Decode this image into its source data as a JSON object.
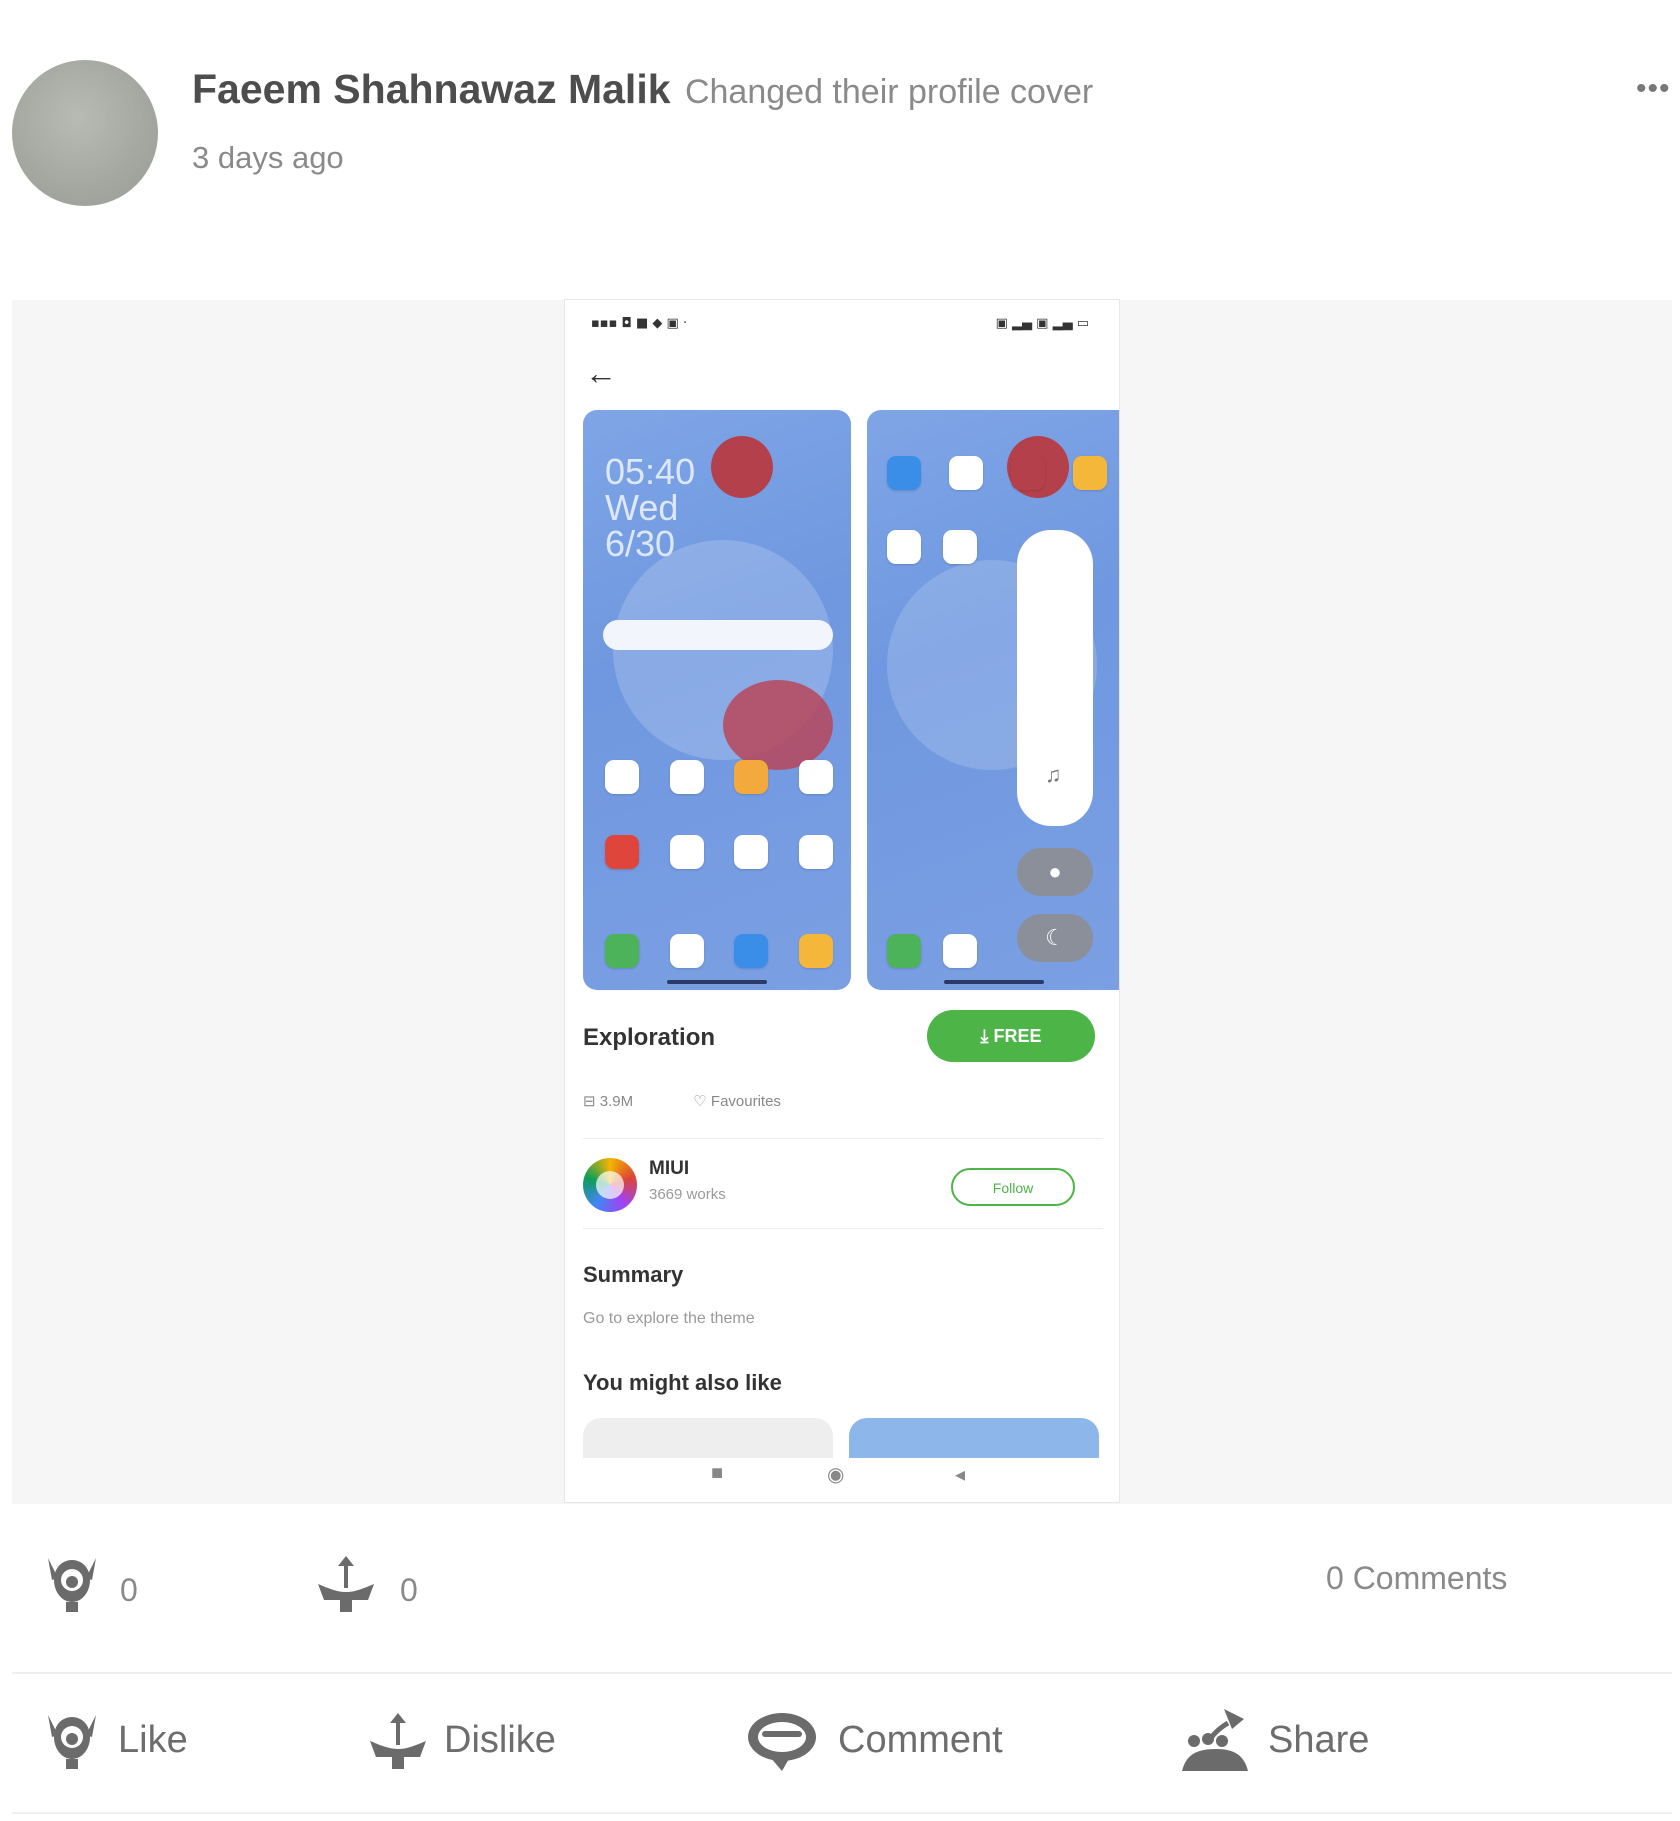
{
  "post": {
    "author": "Faeem Shahnawaz Malik",
    "action": "Changed their profile cover",
    "timestamp": "3 days ago",
    "more_icon": "more-horizontal-icon"
  },
  "screenshot": {
    "theme_name": "Exploration",
    "free_label": "FREE",
    "size": "3.9M",
    "favourites": "Favourites",
    "designer_name": "MIUI",
    "designer_works": "3669 works",
    "follow_label": "Follow",
    "summary_title": "Summary",
    "summary_text": "Go to explore the theme",
    "recommend_title": "You might also like",
    "preview_clock": [
      "05:40",
      "Wed",
      "6/30"
    ]
  },
  "reactions": {
    "like_count": "0",
    "dislike_count": "0",
    "comments": "0 Comments"
  },
  "actions": {
    "like": "Like",
    "dislike": "Dislike",
    "comment": "Comment",
    "share": "Share"
  },
  "colors": {
    "accent_green": "#4db548",
    "icon_gray": "#707070"
  }
}
